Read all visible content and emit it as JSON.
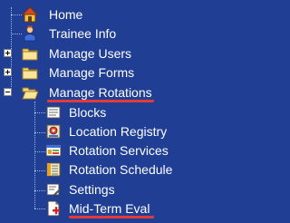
{
  "nav": {
    "home": {
      "label": "Home",
      "icon": "home-icon"
    },
    "trainee_info": {
      "label": "Trainee Info",
      "icon": "person-icon"
    },
    "manage_users": {
      "label": "Manage Users",
      "icon": "folder-icon",
      "expanded": false
    },
    "manage_forms": {
      "label": "Manage Forms",
      "icon": "folder-icon",
      "expanded": false
    },
    "manage_rotations": {
      "label": "Manage Rotations",
      "icon": "folder-open-icon",
      "expanded": true,
      "children": [
        {
          "label": "Blocks",
          "icon": "blocks-icon"
        },
        {
          "label": "Location Registry",
          "icon": "location-registry-icon"
        },
        {
          "label": "Rotation Services",
          "icon": "rotation-services-icon"
        },
        {
          "label": "Rotation Schedule",
          "icon": "rotation-schedule-icon"
        },
        {
          "label": "Settings",
          "icon": "settings-icon"
        },
        {
          "label": "Mid-Term Eval",
          "icon": "mid-term-eval-icon"
        }
      ]
    }
  },
  "colors": {
    "background": "#1f3e94",
    "text": "#ffffff",
    "highlight_underline": "#e23a3a"
  }
}
